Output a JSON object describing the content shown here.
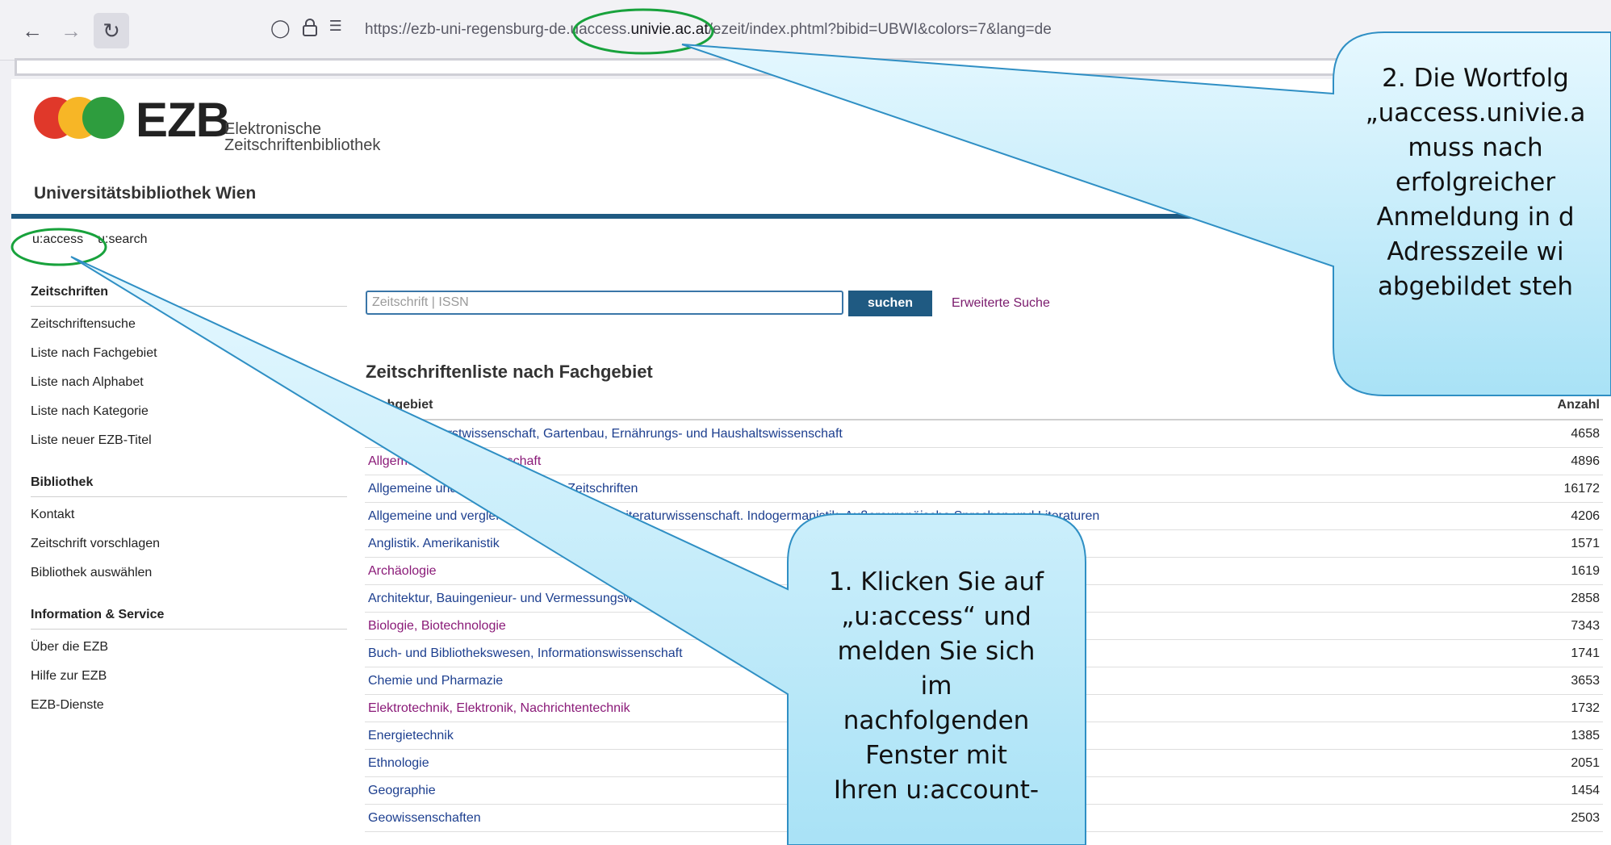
{
  "browser": {
    "url_prefix": "https://ezb-uni-regensburg-de.",
    "url_host_a": "uaccess.",
    "url_host_b": "univie.ac.at",
    "url_suffix": "/ezeit/index.phtml?bibid=UBWI&colors=7&lang=de"
  },
  "logo": {
    "word": "EZB",
    "sub_line1": "Elektronische",
    "sub_line2": "Zeitschriftenbibliothek"
  },
  "library_name": "Universitätsbibliothek Wien",
  "topnav": [
    "u:access",
    "u:search"
  ],
  "sidebar": {
    "sections": [
      {
        "title": "Zeitschriften",
        "items": [
          "Zeitschriftensuche",
          "Liste nach Fachgebiet",
          "Liste nach Alphabet",
          "Liste nach Kategorie",
          "Liste neuer EZB-Titel"
        ]
      },
      {
        "title": "Bibliothek",
        "items": [
          "Kontakt",
          "Zeitschrift vorschlagen",
          "Bibliothek auswählen"
        ]
      },
      {
        "title": "Information & Service",
        "items": [
          "Über die EZB",
          "Hilfe zur EZB",
          "EZB-Dienste"
        ]
      }
    ]
  },
  "search": {
    "placeholder": "Zeitschrift | ISSN",
    "button": "suchen",
    "advanced": "Erweiterte Suche"
  },
  "list": {
    "title": "Zeitschriftenliste nach Fachgebiet",
    "col_subject": "Fachgebiet",
    "col_count": "Anzahl",
    "rows": [
      {
        "name": "Agrar- und Forstwissenschaft, Gartenbau, Ernährungs- und Haushaltswissenschaft",
        "count": "4658",
        "visited": false
      },
      {
        "name": "Allgemeine Naturwissenschaft",
        "count": "4896",
        "visited": true
      },
      {
        "name": "Allgemeine und nicht zuordenbare Zeitschriften",
        "count": "16172",
        "visited": false
      },
      {
        "name": "Allgemeine und vergleichende Sprach- und Literaturwissenschaft. Indogermanistik. Außereuropäische Sprachen und Literaturen",
        "count": "4206",
        "visited": false
      },
      {
        "name": "Anglistik. Amerikanistik",
        "count": "1571",
        "visited": false
      },
      {
        "name": "Archäologie",
        "count": "1619",
        "visited": true
      },
      {
        "name": "Architektur, Bauingenieur- und Vermessungswesen",
        "count": "2858",
        "visited": false
      },
      {
        "name": "Biologie, Biotechnologie",
        "count": "7343",
        "visited": true
      },
      {
        "name": "Buch- und Bibliothekswesen, Informationswissenschaft",
        "count": "1741",
        "visited": false
      },
      {
        "name": "Chemie und Pharmazie",
        "count": "3653",
        "visited": false
      },
      {
        "name": "Elektrotechnik, Elektronik, Nachrichtentechnik",
        "count": "1732",
        "visited": true
      },
      {
        "name": "Energietechnik",
        "count": "1385",
        "visited": false
      },
      {
        "name": "Ethnologie",
        "count": "2051",
        "visited": false
      },
      {
        "name": "Geographie",
        "count": "1454",
        "visited": false
      },
      {
        "name": "Geowissenschaften",
        "count": "2503",
        "visited": false
      }
    ]
  },
  "callouts": {
    "one": [
      "1. Klicken Sie auf",
      "„u:access“ und",
      "melden Sie sich",
      "im",
      "nachfolgenden",
      "Fenster mit",
      "Ihren u:account-"
    ],
    "two": [
      "2. Die Wortfolg",
      "„uaccess.univie.a",
      "muss nach",
      "erfolgreicher",
      "Anmeldung in d",
      "Adresszeile wi",
      "abgebildet steh"
    ]
  },
  "colors": {
    "highlight_ring": "#18a23c",
    "callout_fill": "#cbeefb",
    "callout_stroke": "#2f8fc4",
    "accent_blue": "#1f5a82"
  }
}
